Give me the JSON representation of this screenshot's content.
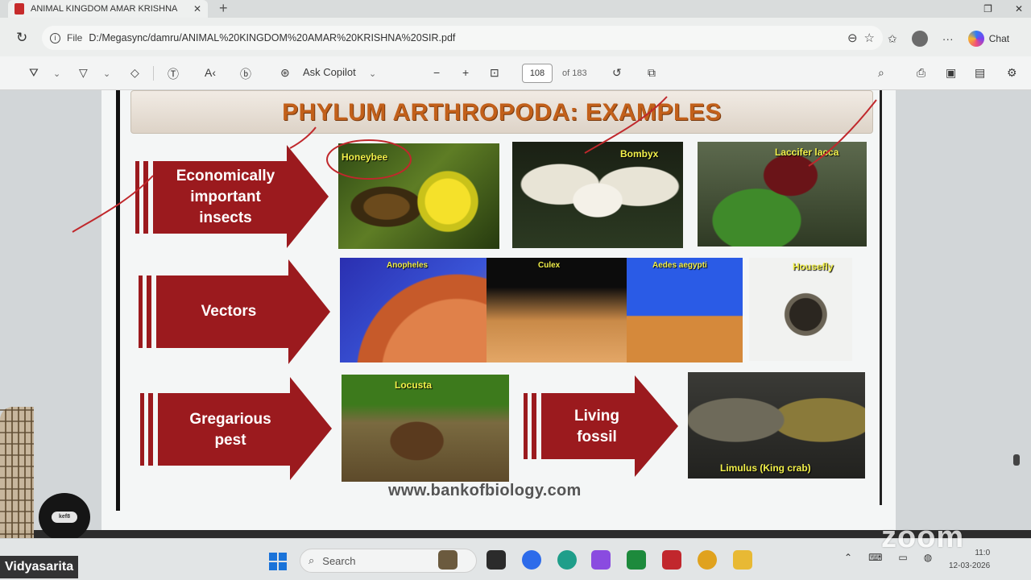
{
  "browser": {
    "tab_title": "ANIMAL KINGDOM AMAR KRISHNA",
    "tab_close": "✕",
    "new_tab": "+",
    "url_scheme": "File",
    "url": "D:/Megasync/damru/ANIMAL%20KINGDOM%20AMAR%20KRISHNA%20SIR.pdf",
    "chat_label": "Chat"
  },
  "pdf_toolbar": {
    "ask_copilot": "Ask Copilot",
    "page_number": "108",
    "page_total": "of 183"
  },
  "slide": {
    "title_main": "PHYLUM ARTHROPODA",
    "title_sep": ": ",
    "title_tail": "EXAMPLES",
    "rows": [
      {
        "label_lines": [
          "Economically",
          "important",
          "insects"
        ]
      },
      {
        "label_lines": [
          "Vectors"
        ]
      },
      {
        "label_lines": [
          "Gregarious",
          "pest"
        ]
      }
    ],
    "living_fossil_lines": [
      "Living",
      "fossil"
    ],
    "images": {
      "honeybee": "Honeybee",
      "bombyx": "Bombyx",
      "laccifer": "Laccifer lacca",
      "anopheles": "Anopheles",
      "culex": "Culex",
      "aedes": "Aedes aegypti",
      "housefly": "Housefly",
      "locusta": "Locusta",
      "limulus": "Limulus (King crab)"
    },
    "website": "www.bankofbiology.com"
  },
  "taskbar": {
    "search_label": "Search",
    "clock_time": "11:0",
    "clock_date": "12-03-2026"
  },
  "zoom": {
    "watermark": "zoom",
    "participant_name": "Vidyasarita",
    "badge_text": "kef8"
  },
  "colors": {
    "arrow_red": "#9b1a1e",
    "title_orange": "#c2601a",
    "label_yellow": "#f2f04a",
    "annotation_red": "#c0282c"
  }
}
